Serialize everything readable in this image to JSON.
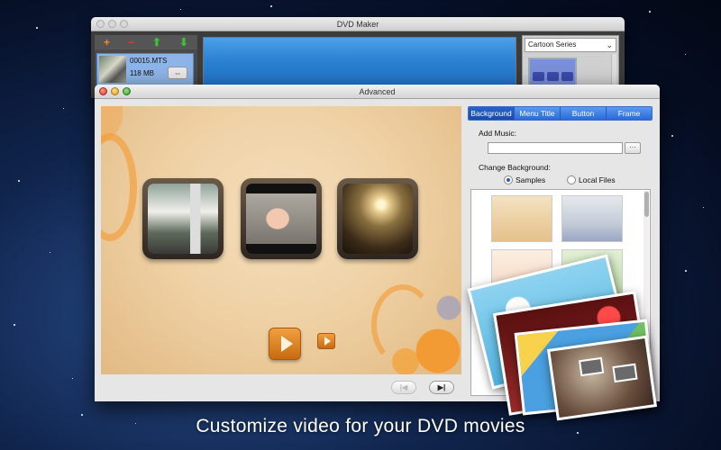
{
  "caption": "Customize video for your DVD movies",
  "main_window": {
    "title": "DVD Maker",
    "toolbar": {
      "add": "+",
      "remove": "−",
      "up": "⬆",
      "down": "⬇"
    },
    "file": {
      "name": "00015.MTS",
      "size": "118 MB",
      "link_icon": "⇔"
    },
    "theme_select": {
      "value": "Cartoon Series",
      "chevron": "⌄"
    }
  },
  "advanced_window": {
    "title": "Advanced",
    "tabs": [
      "Background",
      "Menu Title",
      "Button",
      "Frame"
    ],
    "active_tab": "Background",
    "add_music_label": "Add Music:",
    "music_value": "",
    "browse_label": "···",
    "change_bg_label": "Change Background:",
    "radio_samples": "Samples",
    "radio_local": "Local Files",
    "selected_source": "Samples",
    "nav_prev": "|◀",
    "nav_next": "▶|",
    "colors": {
      "tab_blue": "#2a6ad8",
      "button_orange": "#e08a2a",
      "canvas_bg": "#eed0a3"
    }
  }
}
